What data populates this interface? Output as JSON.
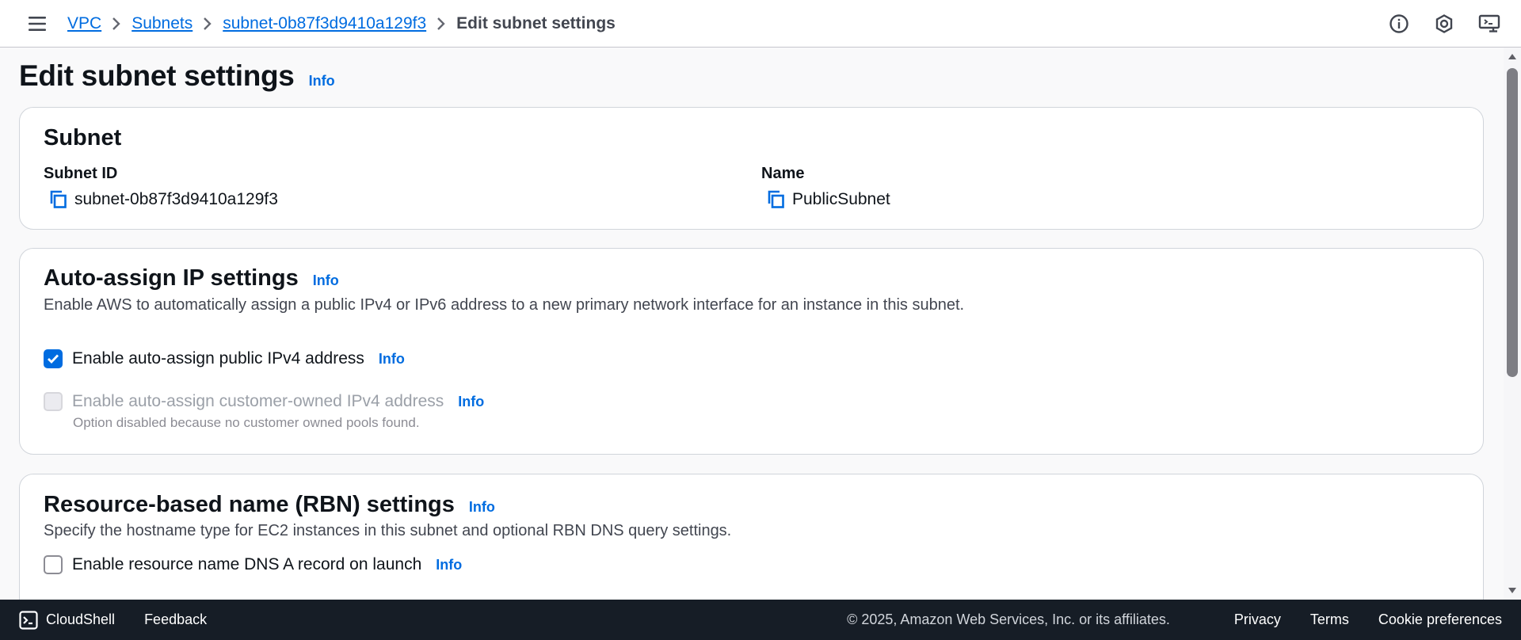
{
  "breadcrumb": {
    "items": [
      "VPC",
      "Subnets",
      "subnet-0b87f3d9410a129f3"
    ],
    "current": "Edit subnet settings"
  },
  "header": {
    "icons": [
      "info-icon",
      "notifications-icon",
      "screen-share-icon"
    ]
  },
  "page": {
    "title": "Edit subnet settings",
    "info": "Info"
  },
  "subnet_card": {
    "title": "Subnet",
    "subnet_id_label": "Subnet ID",
    "subnet_id_value": "subnet-0b87f3d9410a129f3",
    "name_label": "Name",
    "name_value": "PublicSubnet"
  },
  "auto_assign_card": {
    "title": "Auto-assign IP settings",
    "info": "Info",
    "description": "Enable AWS to automatically assign a public IPv4 or IPv6 address to a new primary network interface for an instance in this subnet.",
    "public_ipv4": {
      "label": "Enable auto-assign public IPv4 address",
      "info": "Info",
      "checked": true
    },
    "customer_owned_ipv4": {
      "label": "Enable auto-assign customer-owned IPv4 address",
      "info": "Info",
      "checked": false,
      "disabled": true,
      "hint": "Option disabled because no customer owned pools found."
    }
  },
  "rbn_card": {
    "title": "Resource-based name (RBN) settings",
    "info": "Info",
    "description": "Specify the hostname type for EC2 instances in this subnet and optional RBN DNS query settings.",
    "dns_a_record": {
      "label": "Enable resource name DNS A record on launch",
      "info": "Info",
      "checked": false
    }
  },
  "footer": {
    "cloudshell": "CloudShell",
    "feedback": "Feedback",
    "copyright": "© 2025, Amazon Web Services, Inc. or its affiliates.",
    "links": [
      "Privacy",
      "Terms",
      "Cookie preferences"
    ]
  },
  "colors": {
    "link": "#006ce0",
    "footer_bg": "#161d26",
    "checkbox_checked": "#006ce0"
  }
}
